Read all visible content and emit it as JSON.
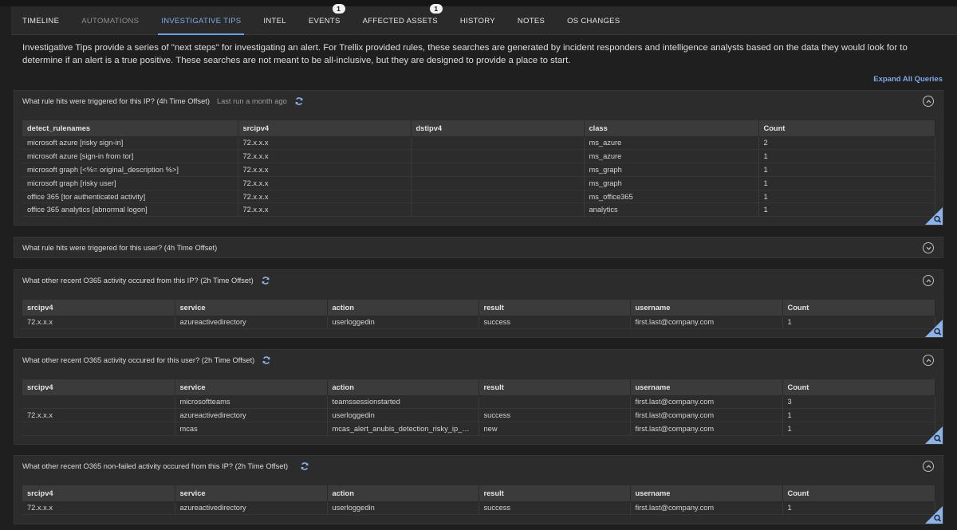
{
  "tabs": [
    {
      "label": "TIMELINE",
      "state": "normal",
      "badge": null
    },
    {
      "label": "AUTOMATIONS",
      "state": "dim",
      "badge": null
    },
    {
      "label": "INVESTIGATIVE TIPS",
      "state": "active",
      "badge": null
    },
    {
      "label": "INTEL",
      "state": "normal",
      "badge": null
    },
    {
      "label": "EVENTS",
      "state": "normal",
      "badge": "1"
    },
    {
      "label": "AFFECTED ASSETS",
      "state": "normal",
      "badge": "1"
    },
    {
      "label": "HISTORY",
      "state": "normal",
      "badge": null
    },
    {
      "label": "NOTES",
      "state": "normal",
      "badge": null
    },
    {
      "label": "OS CHANGES",
      "state": "normal",
      "badge": null
    }
  ],
  "intro_text": "Investigative Tips provide a series of \"next steps\" for investigating an alert. For Trellix provided rules, these searches are generated by incident responders and intelligence analysts based on the data they would look for to determine if an alert is a true positive. These searches are not meant to be all-inclusive, but they are designed to provide a place to start.",
  "expand_all_label": "Expand All Queries",
  "colors": {
    "accent": "#7fa9e6",
    "background": "#1f1f1f",
    "panel": "#2c2c2c",
    "header_row": "#3b3b3b"
  },
  "panels": {
    "p1": {
      "title": "What rule hits were triggered for this IP? (4h Time Offset)",
      "last_run": "Last run a month ago",
      "expanded": true,
      "columns": [
        "detect_rulenames",
        "srcipv4",
        "dstipv4",
        "class",
        "Count"
      ],
      "rows": [
        [
          "microsoft azure [risky sign-in]",
          "72.x.x.x",
          "",
          "ms_azure",
          "2"
        ],
        [
          "microsoft azure [sign-in from tor]",
          "72.x.x.x",
          "",
          "ms_azure",
          "1"
        ],
        [
          "microsoft graph [<%= original_description %>]",
          "72.x.x.x",
          "",
          "ms_graph",
          "1"
        ],
        [
          "microsoft graph [risky user]",
          "72.x.x.x",
          "",
          "ms_graph",
          "1"
        ],
        [
          "office 365 [tor authenticated activity]",
          "72.x.x.x",
          "",
          "ms_office365",
          "1"
        ],
        [
          "office 365 analytics [abnormal logon]",
          "72.x.x.x",
          "",
          "analytics",
          "1"
        ]
      ]
    },
    "p2": {
      "title": "What rule hits were triggered for this user? (4h Time Offset)",
      "expanded": false
    },
    "p3": {
      "title": "What other recent O365 activity occured from this IP? (2h Time Offset)",
      "expanded": true,
      "columns": [
        "srcipv4",
        "service",
        "action",
        "result",
        "username",
        "Count"
      ],
      "rows": [
        [
          "72.x.x.x",
          "azureactivedirectory",
          "userloggedin",
          "success",
          "first.last@company.com",
          "1"
        ]
      ]
    },
    "p4": {
      "title": "What other recent O365 activity occured for this user? (2h Time Offset)",
      "expanded": true,
      "columns": [
        "srcipv4",
        "service",
        "action",
        "result",
        "username",
        "Count"
      ],
      "rows": [
        [
          "",
          "microsoftteams",
          "teamssessionstarted",
          "",
          "first.last@company.com",
          "3"
        ],
        [
          "72.x.x.x",
          "azureactivedirectory",
          "userloggedin",
          "success",
          "first.last@company.com",
          "1"
        ],
        [
          "",
          "mcas",
          "mcas_alert_anubis_detection_risky_ip_ano...",
          "new",
          "first.last@company.com",
          "1"
        ]
      ]
    },
    "p5": {
      "title": "What other recent O365 non-failed activity occured from this IP? (2h Time Offset)",
      "expanded": true,
      "columns": [
        "srcipv4",
        "service",
        "action",
        "result",
        "username",
        "Count"
      ],
      "rows": [
        [
          "72.x.x.x",
          "azureactivedirectory",
          "userloggedin",
          "success",
          "first.last@company.com",
          "1"
        ]
      ]
    }
  }
}
